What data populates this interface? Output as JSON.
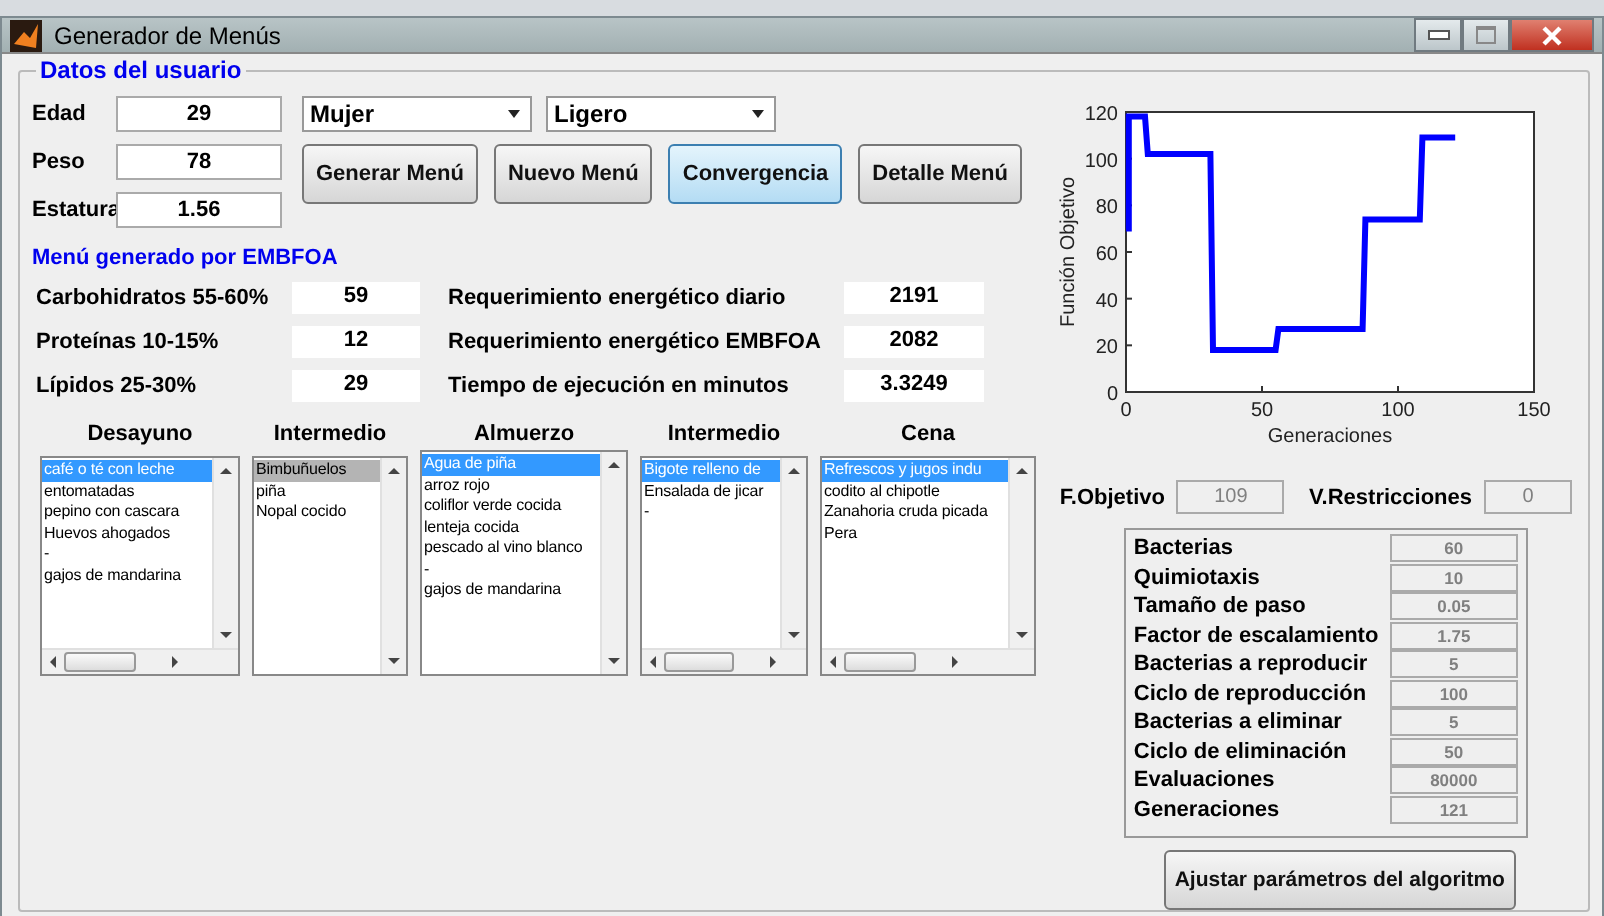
{
  "window": {
    "title": "Generador de Menús"
  },
  "user_data": {
    "title": "Datos del usuario",
    "fields": [
      {
        "label": "Edad",
        "value": "29"
      },
      {
        "label": "Peso",
        "value": "78"
      },
      {
        "label": "Estatura",
        "value": "1.56"
      }
    ],
    "dropdowns": [
      {
        "value": "Mujer"
      },
      {
        "value": "Ligero"
      }
    ],
    "buttons": [
      {
        "label": "Generar Menú",
        "focused": false
      },
      {
        "label": "Nuevo Menú",
        "focused": false
      },
      {
        "label": "Convergencia",
        "focused": true
      },
      {
        "label": "Detalle Menú",
        "focused": false
      }
    ]
  },
  "results": {
    "title": "Menú generado por EMBFOA",
    "macros": [
      {
        "label": "Carbohidratos 55-60%",
        "value": "59"
      },
      {
        "label": "Proteínas 10-15%",
        "value": "12"
      },
      {
        "label": "Lípidos 25-30%",
        "value": "29"
      }
    ],
    "energy": [
      {
        "label": "Requerimiento energético diario",
        "value": "2191"
      },
      {
        "label": "Requerimiento energético EMBFOA",
        "value": "2082"
      },
      {
        "label": "Tiempo de ejecución en minutos",
        "value": "3.3249"
      }
    ]
  },
  "meals": [
    {
      "title": "Desayuno",
      "active": true,
      "h_scroll": true,
      "items": [
        {
          "text": "café o té con leche",
          "selected": true
        },
        {
          "text": "entomatadas",
          "selected": false
        },
        {
          "text": "pepino con cascara",
          "selected": false
        },
        {
          "text": "Huevos ahogados",
          "selected": false
        },
        {
          "text": "-",
          "selected": false
        },
        {
          "text": "gajos de mandarina",
          "selected": false
        }
      ]
    },
    {
      "title": "Intermedio",
      "active": false,
      "h_scroll": false,
      "items": [
        {
          "text": "Bimbuñuelos",
          "selected": true
        },
        {
          "text": "piña",
          "selected": false
        },
        {
          "text": "Nopal cocido",
          "selected": false
        }
      ]
    },
    {
      "title": "Almuerzo",
      "active": true,
      "h_scroll": false,
      "items": [
        {
          "text": "Agua de piña",
          "selected": true
        },
        {
          "text": "arroz rojo",
          "selected": false
        },
        {
          "text": "coliflor verde cocida",
          "selected": false
        },
        {
          "text": "lenteja cocida",
          "selected": false
        },
        {
          "text": "pescado al vino blanco",
          "selected": false
        },
        {
          "text": "-",
          "selected": false
        },
        {
          "text": "gajos de mandarina",
          "selected": false
        }
      ]
    },
    {
      "title": "Intermedio",
      "active": true,
      "h_scroll": true,
      "items": [
        {
          "text": "Bigote relleno de",
          "selected": true
        },
        {
          "text": "Ensalada de jicar",
          "selected": false
        },
        {
          "text": "-",
          "selected": false
        }
      ]
    },
    {
      "title": "Cena",
      "active": true,
      "h_scroll": true,
      "items": [
        {
          "text": "Refrescos y jugos indu",
          "selected": true
        },
        {
          "text": "codito al chipotle",
          "selected": false
        },
        {
          "text": "Zanahoria cruda picada",
          "selected": false
        },
        {
          "text": "Pera",
          "selected": false
        }
      ]
    }
  ],
  "convergence": {
    "chart_data": {
      "type": "line",
      "xlabel": "Generaciones",
      "ylabel": "Función Objetivo",
      "xlim": [
        0,
        150
      ],
      "ylim": [
        0,
        120
      ],
      "xticks": [
        0,
        50,
        100,
        150
      ],
      "yticks": [
        0,
        20,
        40,
        60,
        80,
        100,
        120
      ],
      "x": [
        0,
        1,
        1,
        7,
        8,
        31,
        32,
        55,
        56,
        87,
        88,
        108,
        109,
        121
      ],
      "series": [
        {
          "color": "#0000ff",
          "values": [
            70,
            70,
            118,
            118,
            102,
            102,
            18,
            18,
            27,
            27,
            74,
            74,
            109,
            109
          ]
        }
      ]
    }
  },
  "summary": [
    {
      "label": "F.Objetivo",
      "value": "109",
      "disabled": true
    },
    {
      "label": "V.Restricciones",
      "value": "0",
      "disabled": true
    }
  ],
  "parameters": [
    {
      "label": "Bacterias",
      "value": "60",
      "disabled": true
    },
    {
      "label": "Quimiotaxis",
      "value": "10",
      "disabled": true
    },
    {
      "label": "Tamaño de paso",
      "value": "0.05",
      "disabled": true
    },
    {
      "label": "Factor de escalamiento",
      "value": "1.75",
      "disabled": true
    },
    {
      "label": "Bacterias a reproducir",
      "value": "5",
      "disabled": true
    },
    {
      "label": "Ciclo de reproducción",
      "value": "100",
      "disabled": true
    },
    {
      "label": "Bacterias a eliminar",
      "value": "5",
      "disabled": true
    },
    {
      "label": "Ciclo de eliminación",
      "value": "50",
      "disabled": true
    },
    {
      "label": "Evaluaciones",
      "value": "80000",
      "disabled": true
    },
    {
      "label": "Generaciones",
      "value": "121",
      "disabled": true
    }
  ],
  "adjust_button": {
    "label": "Ajustar parámetros del algoritmo"
  }
}
